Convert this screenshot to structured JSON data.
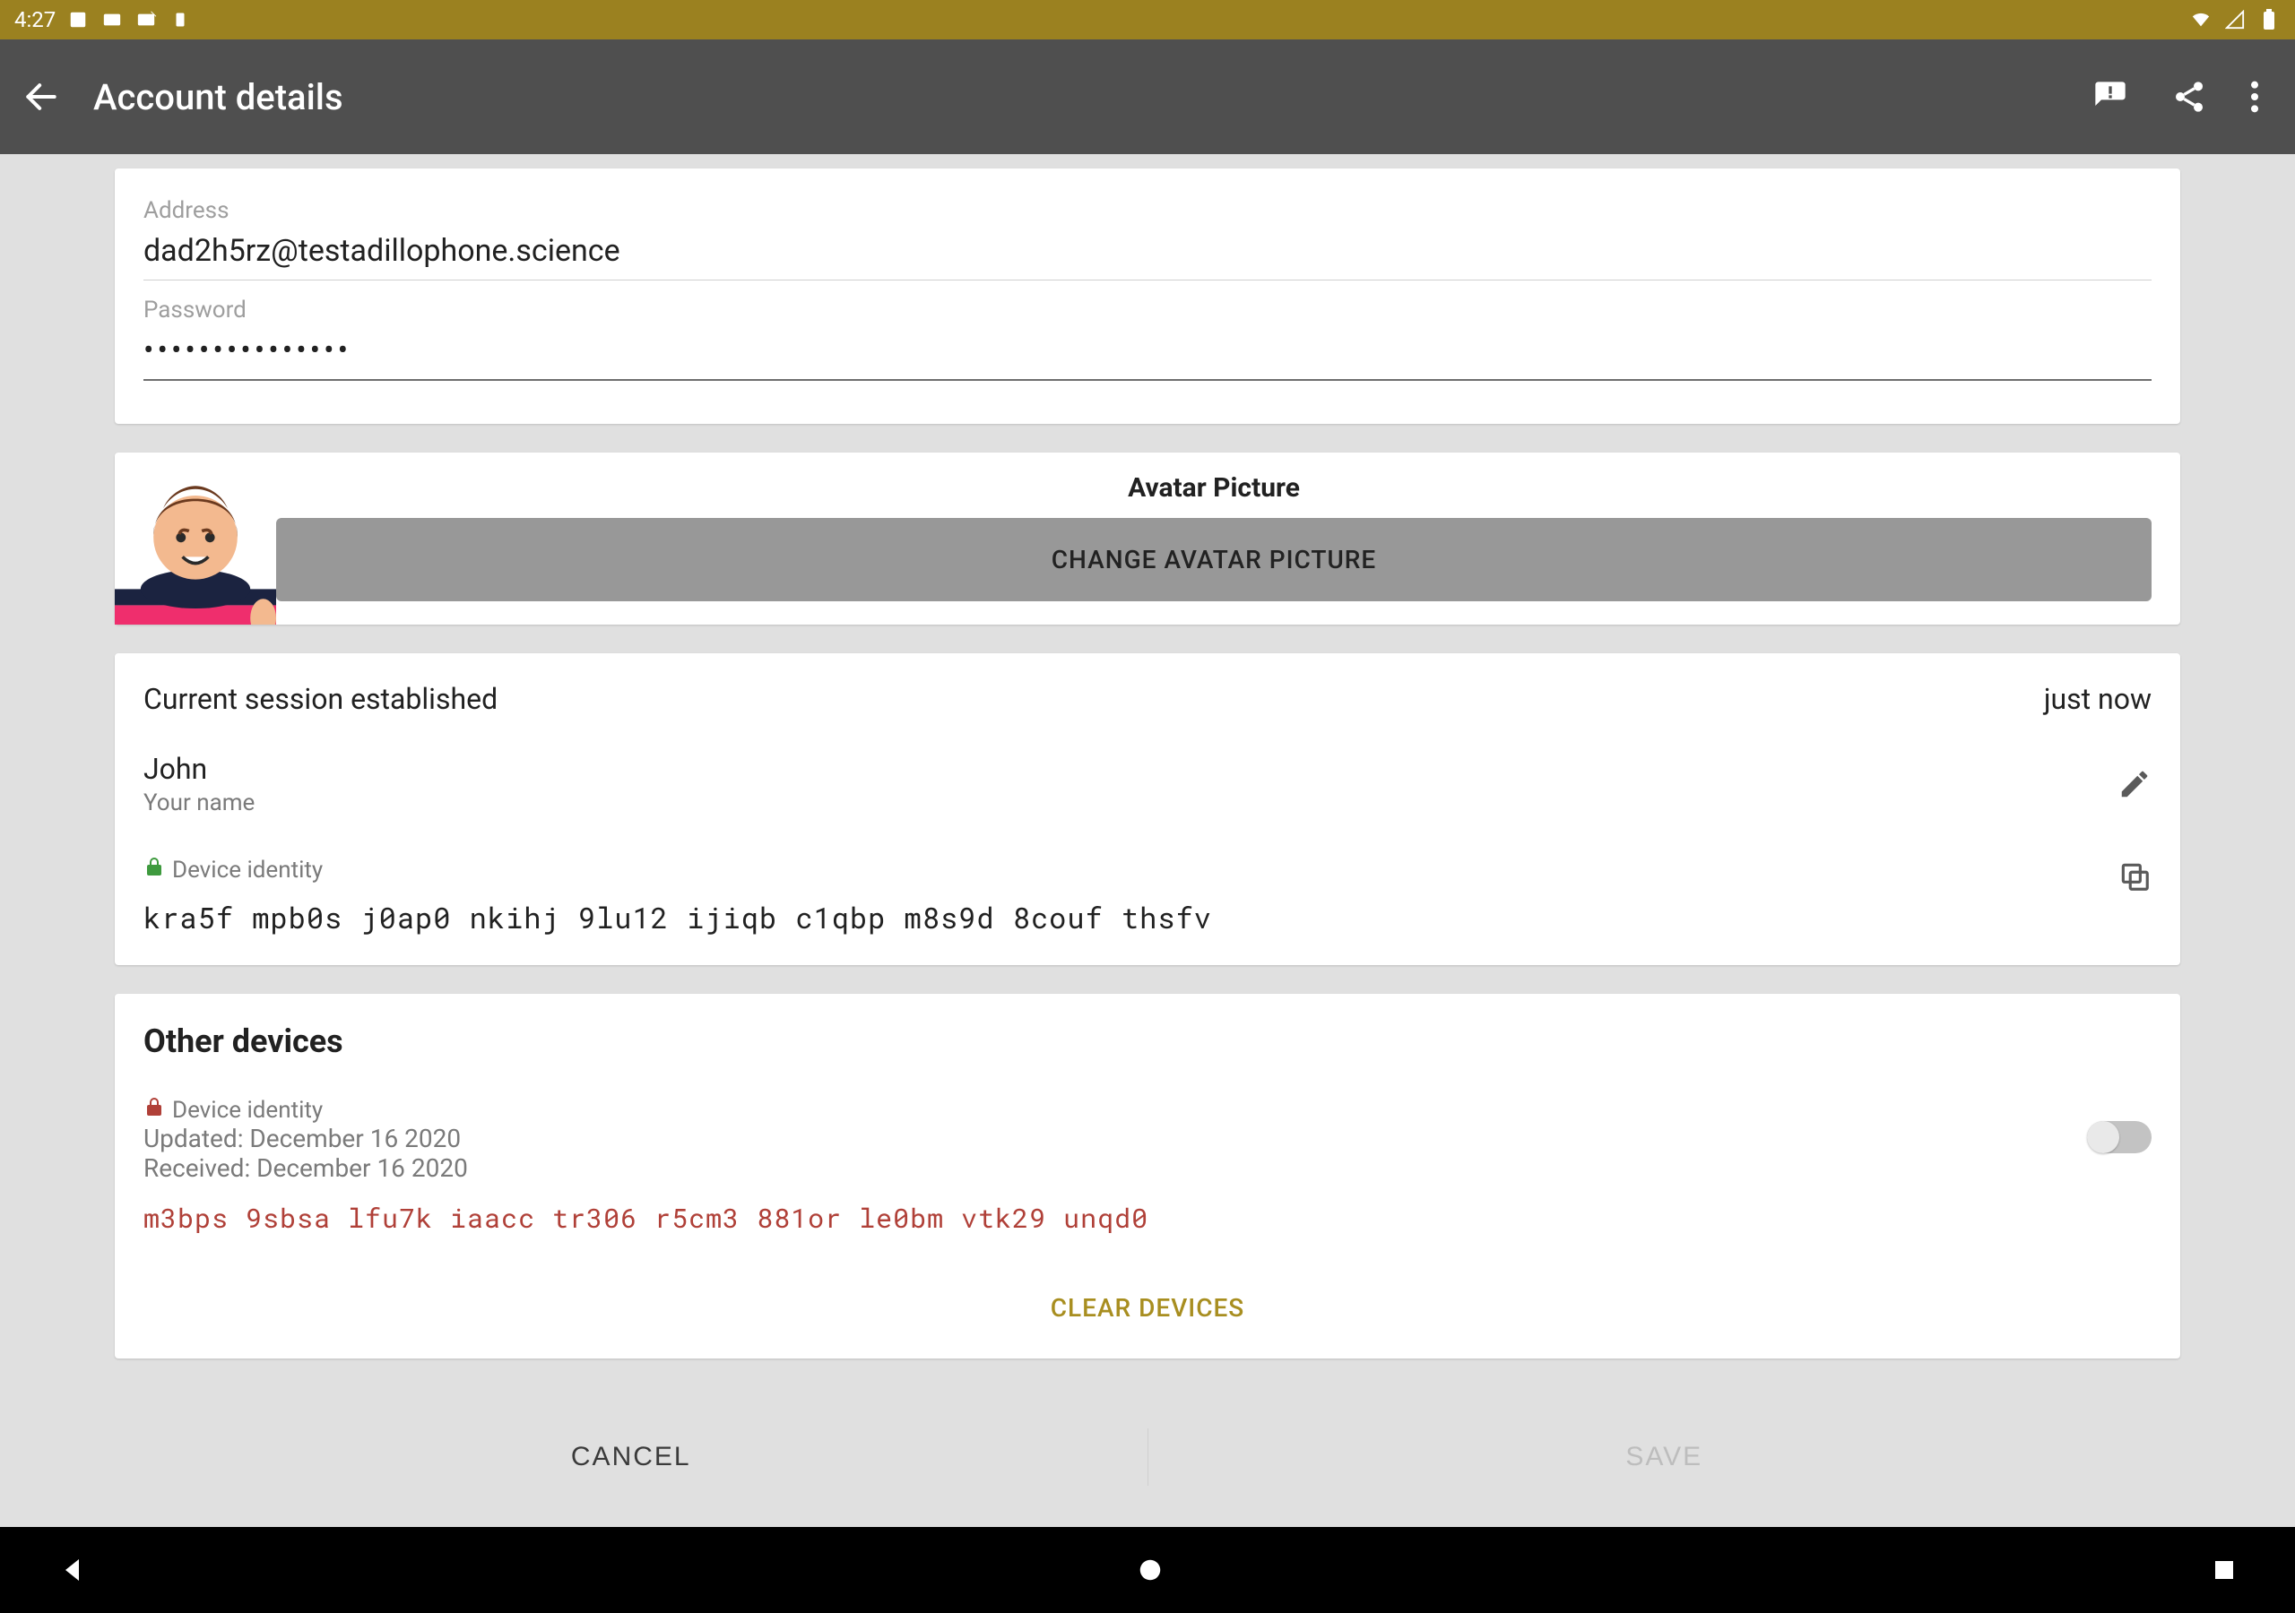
{
  "status": {
    "time": "4:27"
  },
  "app_bar": {
    "title": "Account details"
  },
  "credentials": {
    "address_label": "Address",
    "address_value": "dad2h5rz@testadillophone.science",
    "password_label": "Password",
    "password_masked": "•••••••••••••••"
  },
  "avatar": {
    "title": "Avatar Picture",
    "change_button": "CHANGE AVATAR PICTURE"
  },
  "session": {
    "status_text": "Current session established",
    "status_time": "just now",
    "display_name": "John",
    "display_name_hint": "Your name",
    "device_identity_label": "Device identity",
    "fingerprint": "kra5f mpb0s j0ap0 nkihj 9lu12 ijiqb c1qbp m8s9d 8couf thsfv"
  },
  "other_devices": {
    "title": "Other devices",
    "device_identity_label": "Device identity",
    "updated_line": "Updated: December 16 2020",
    "received_line": "Received: December 16 2020",
    "fingerprint": "m3bps 9sbsa lfu7k iaacc tr306 r5cm3 881or le0bm vtk29 unqd0",
    "toggle_on": false,
    "clear_button": "CLEAR DEVICES"
  },
  "actions": {
    "cancel": "CANCEL",
    "save": "SAVE"
  },
  "colors": {
    "accent": "#a88e20",
    "status_bar": "#9b8120",
    "app_bar": "#4f4f4f",
    "danger": "#b04038",
    "secure": "#3e9a3e"
  }
}
